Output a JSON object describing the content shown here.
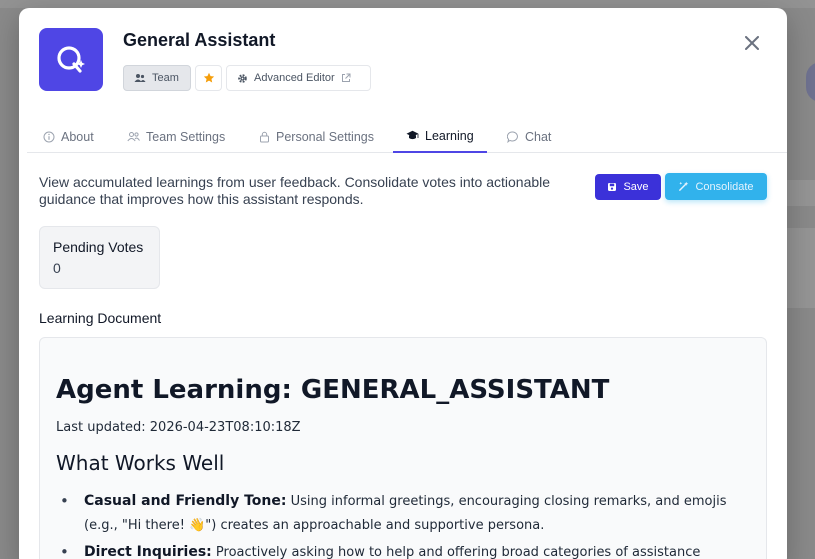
{
  "header": {
    "title": "General Assistant",
    "chips": {
      "team": "Team",
      "editor": "Advanced Editor"
    }
  },
  "tabs": [
    {
      "label": "About",
      "icon": "info-icon"
    },
    {
      "label": "Team Settings",
      "icon": "users-icon"
    },
    {
      "label": "Personal Settings",
      "icon": "lock-icon"
    },
    {
      "label": "Learning",
      "icon": "graduation-cap-icon",
      "active": true
    },
    {
      "label": "Chat",
      "icon": "chat-icon"
    }
  ],
  "learning": {
    "description": "View accumulated learnings from user feedback. Consolidate votes into actionable guidance that improves how this assistant responds.",
    "save_label": "Save",
    "consolidate_label": "Consolidate",
    "pending_votes_label": "Pending Votes",
    "pending_votes_value": "0",
    "document_label": "Learning Document"
  },
  "document": {
    "h1": "Agent Learning: GENERAL_ASSISTANT",
    "last_updated": "Last updated: 2026-04-23T08:10:18Z",
    "h2": "What Works Well",
    "items": [
      {
        "title": "Casual and Friendly Tone:",
        "text": "Using informal greetings, encouraging closing remarks, and emojis (e.g., \"Hi there! 👋\") creates an approachable and supportive persona."
      },
      {
        "title": "Direct Inquiries:",
        "text": "Proactively asking how to help and offering broad categories of assistance"
      }
    ]
  },
  "colors": {
    "accent": "#4f46e5",
    "save": "#3b31d9",
    "consolidate": "#0ea5e9",
    "star": "#f59e0b"
  }
}
